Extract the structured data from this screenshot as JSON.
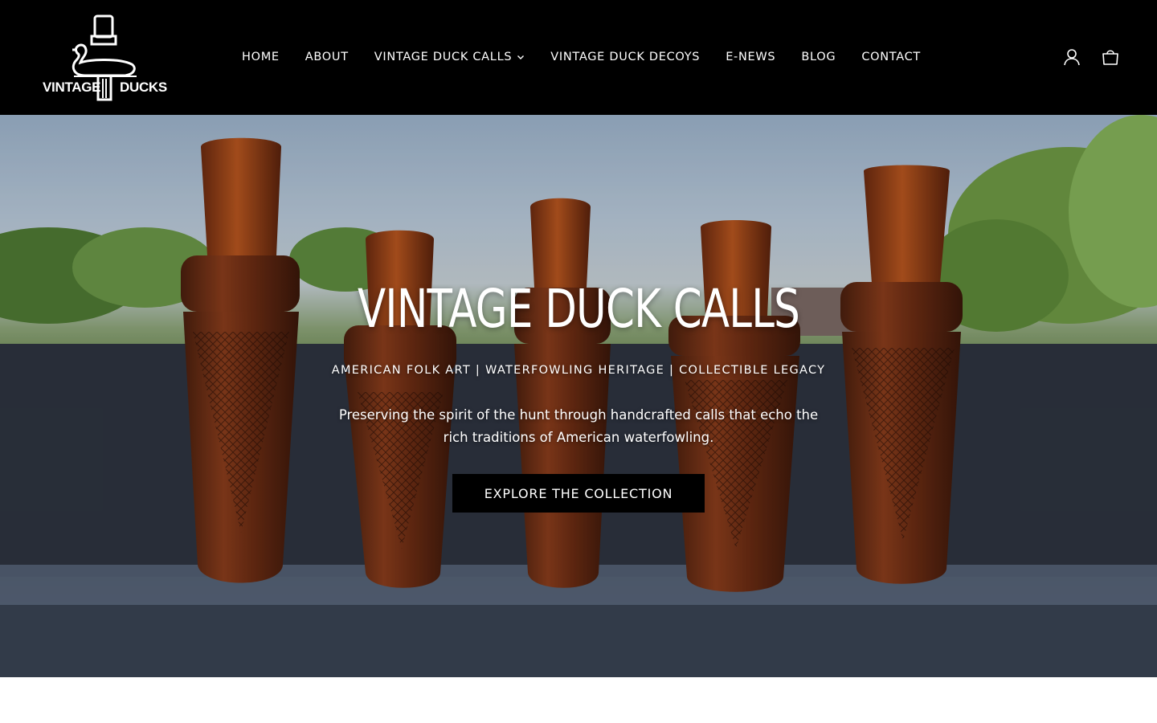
{
  "brand": {
    "logo_word_left": "VINTAGE",
    "logo_word_right": "DUCKS"
  },
  "nav": {
    "items": [
      {
        "label": "HOME"
      },
      {
        "label": "ABOUT"
      },
      {
        "label": "VINTAGE DUCK CALLS",
        "dropdown": true
      },
      {
        "label": "VINTAGE DUCK DECOYS"
      },
      {
        "label": "E-NEWS"
      },
      {
        "label": "BLOG"
      },
      {
        "label": "CONTACT"
      }
    ]
  },
  "header_icons": [
    "account-icon",
    "cart-icon"
  ],
  "hero": {
    "title": "VINTAGE DUCK CALLS",
    "subtitle": "AMERICAN FOLK ART | WATERFOWLING HERITAGE | COLLECTIBLE LEGACY",
    "text": "Preserving the spirit of the hunt through handcrafted calls that echo the rich traditions of American waterfowling.",
    "button_label": "EXPLORE THE COLLECTION"
  },
  "colors": {
    "header_bg": "#000000",
    "button_bg": "#000000",
    "text": "#ffffff",
    "wood": "#7a3a1c"
  }
}
